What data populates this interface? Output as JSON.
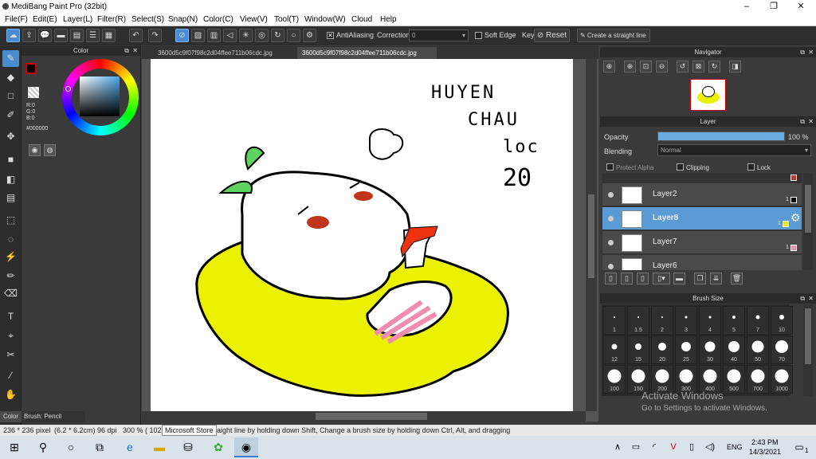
{
  "window": {
    "title": "MediBang Paint Pro (32bit)",
    "minimize": "–",
    "maximize": "❐",
    "close": "✕"
  },
  "menu": [
    "File(F)",
    "Edit(E)",
    "Layer(L)",
    "Filter(R)",
    "Select(S)",
    "Snap(N)",
    "Color(C)",
    "View(V)",
    "Tool(T)",
    "Window(W)",
    "Cloud",
    "Help"
  ],
  "toolbar": {
    "antialiasing": "AntiAliasing",
    "correction_label": "Correction",
    "correction_value": "0",
    "soft_edge": "Soft Edge",
    "key": "Key",
    "reset": "Reset",
    "straight_line": "Create a straight line"
  },
  "color_panel": {
    "header": "Color",
    "r": "R:0",
    "g": "G:0",
    "b": "B:0",
    "hex": "#000000",
    "fg_color": "#000000",
    "bg_color": "#ffffff"
  },
  "left_tabs": {
    "color": "Color",
    "brush": "Brush: Pencil"
  },
  "tabs": [
    "3600d5c9f07f98c2d04ffee711b06cdc.jpg",
    "3600d5c9f07f98c2d04ffee711b06cdc.jpg"
  ],
  "canvas_text": {
    "line1": "HUYEN",
    "line2": "CHAU",
    "line3": "loc",
    "line4": "20"
  },
  "navigator": {
    "header": "Navigator"
  },
  "layer_panel": {
    "header": "Layer",
    "opacity_label": "Opacity",
    "opacity_value": "100 %",
    "opacity": 1.0,
    "blending_label": "Blending",
    "blending_value": "Normal",
    "protect_alpha": "Protect Alpha",
    "clipping": "Clipping",
    "lock": "Lock",
    "layers": [
      {
        "name": "Layer2",
        "num": "1",
        "swatch": "#000000"
      },
      {
        "name": "Layer8",
        "num": "1",
        "swatch": "#e8f000"
      },
      {
        "name": "Layer7",
        "num": "1",
        "swatch": "#f08cb0"
      },
      {
        "name": "Layer6",
        "num": "",
        "swatch": ""
      }
    ],
    "top_swatch": "#c0392b"
  },
  "brush_panel": {
    "header": "Brush Size",
    "sizes": [
      "1",
      "1.5",
      "2",
      "3",
      "4",
      "5",
      "7",
      "10",
      "12",
      "15",
      "20",
      "25",
      "30",
      "40",
      "50",
      "70",
      "100",
      "150",
      "200",
      "300",
      "400",
      "500",
      "700",
      "1000"
    ]
  },
  "activate": {
    "line1": "Activate Windows",
    "line2": "Go to Settings to activate Windows."
  },
  "status": {
    "size": "236 * 236 pixel",
    "cm": "(6.2 * 6.2cm)",
    "dpi": "96 dpi",
    "zoom": "300 %",
    "coord": "( 102",
    "tooltip": "Microsoft Store",
    "hint": "aight line by holding down Shift, Change a brush size by holding down Ctrl, Alt, and dragging"
  },
  "taskbar": {
    "lang": "ENG",
    "time": "2:43 PM",
    "date": "14/3/2021",
    "notif": "1"
  }
}
